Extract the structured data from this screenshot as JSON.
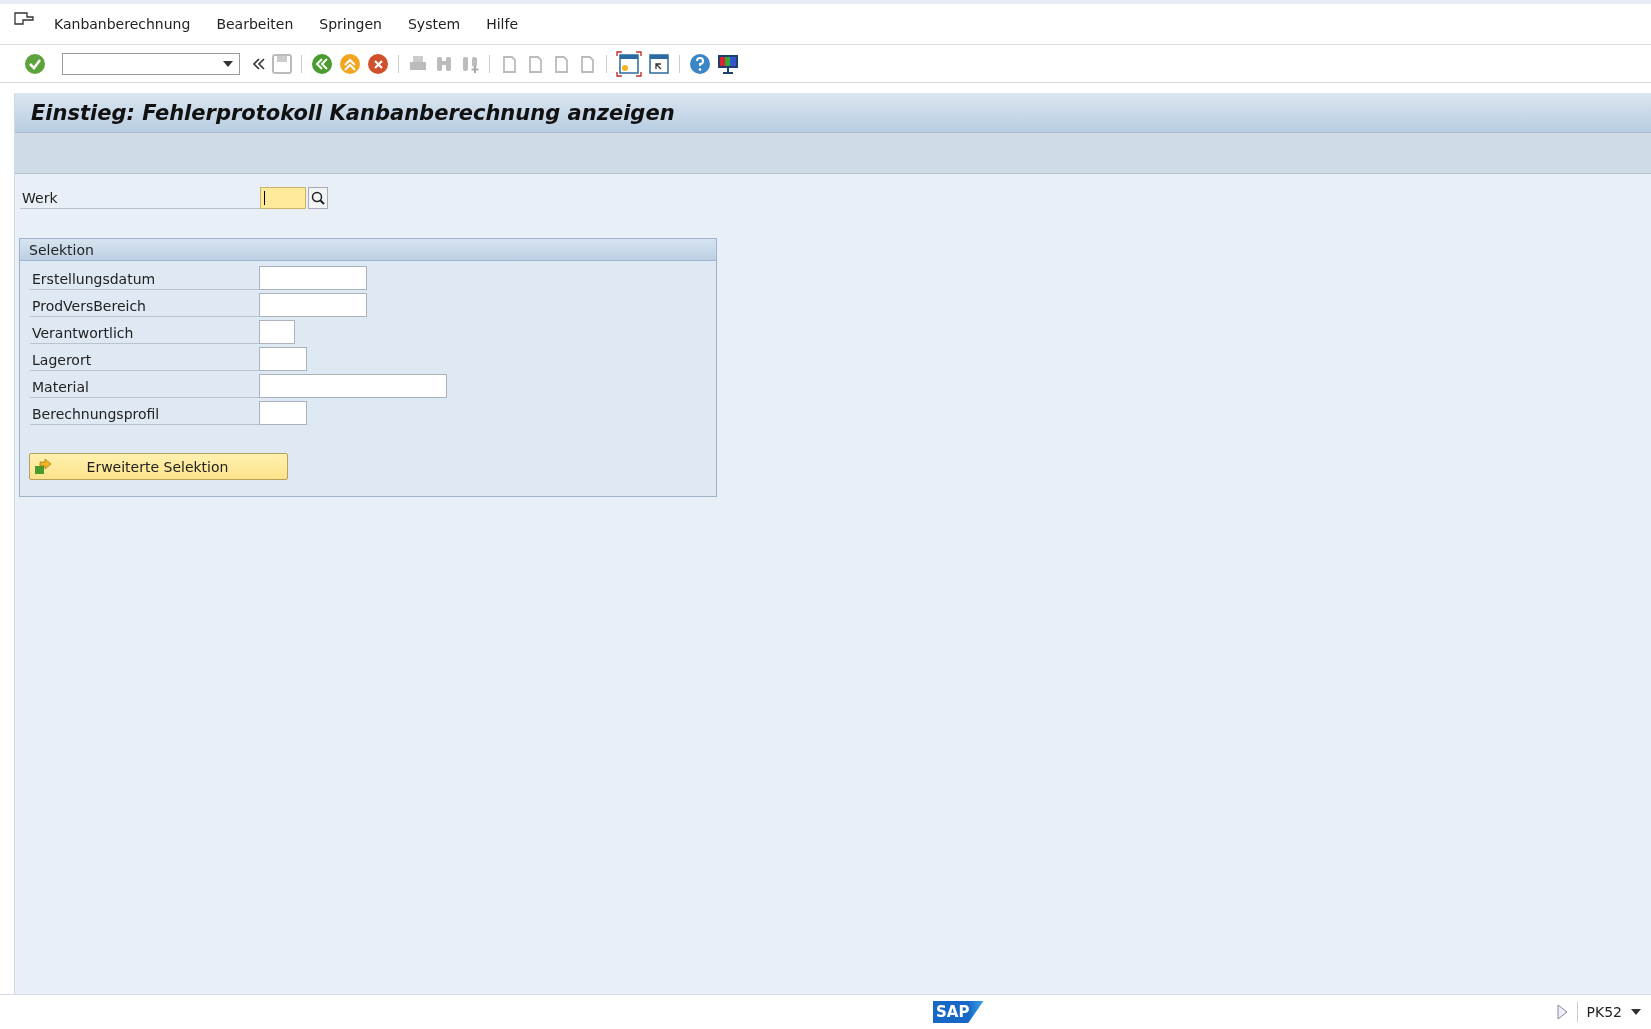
{
  "menu": [
    {
      "label": "Kanbanberechnung"
    },
    {
      "label": "Bearbeiten"
    },
    {
      "label": "Springen"
    },
    {
      "label": "System"
    },
    {
      "label": "Hilfe"
    }
  ],
  "title": "Einstieg: Fehlerprotokoll Kanbanberechnung anzeigen",
  "werk": {
    "label": "Werk"
  },
  "selection": {
    "title": "Selektion",
    "fields": [
      {
        "label": "Erstellungsdatum",
        "kind": "medium"
      },
      {
        "label": "ProdVersBereich",
        "kind": "medium"
      },
      {
        "label": "Verantwortlich",
        "kind": "tiny"
      },
      {
        "label": "Lagerort",
        "kind": "small"
      },
      {
        "label": "Material",
        "kind": "long"
      },
      {
        "label": "Berechnungsprofil",
        "kind": "small"
      }
    ],
    "button": "Erweiterte Selektion"
  },
  "status_bar": {
    "logo": "SAP",
    "transaction": "PK52"
  }
}
